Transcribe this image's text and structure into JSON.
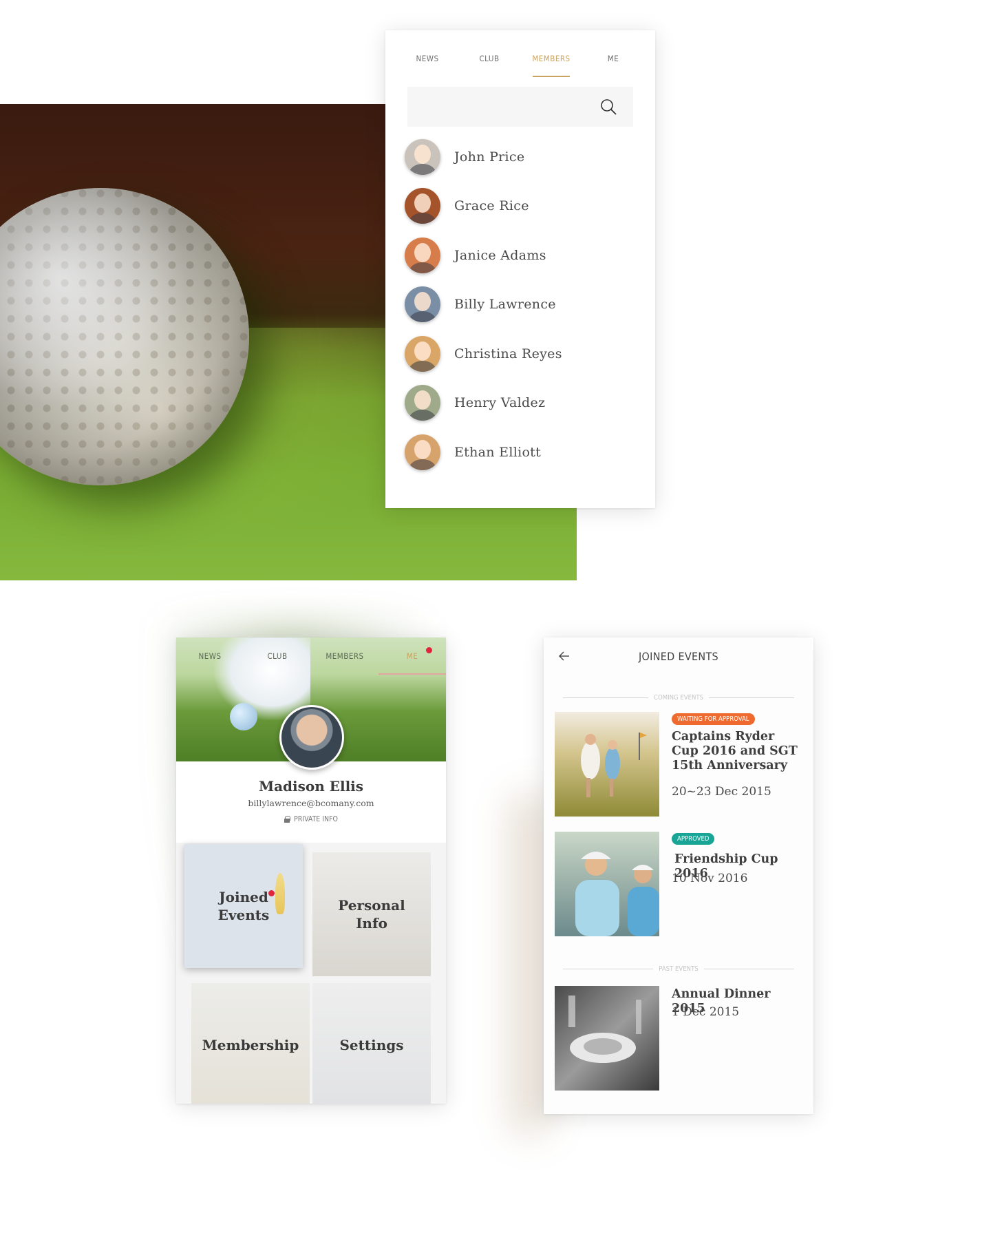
{
  "members_screen": {
    "tabs": [
      {
        "label": "NEWS"
      },
      {
        "label": "CLUB"
      },
      {
        "label": "MEMBERS"
      },
      {
        "label": "ME"
      }
    ],
    "active_tab": "MEMBERS",
    "search": {
      "value": "",
      "placeholder": ""
    },
    "members": [
      {
        "name": "John Price",
        "avatar_color": "#c9c3bb"
      },
      {
        "name": "Grace Rice",
        "avatar_color": "#a4532a"
      },
      {
        "name": "Janice Adams",
        "avatar_color": "#d77d4b"
      },
      {
        "name": "Billy Lawrence",
        "avatar_color": "#7a8fa6"
      },
      {
        "name": "Christina Reyes",
        "avatar_color": "#d9a667"
      },
      {
        "name": "Henry Valdez",
        "avatar_color": "#9eaa8a"
      },
      {
        "name": "Ethan Elliott",
        "avatar_color": "#d7a36c"
      }
    ]
  },
  "profile_screen": {
    "tabs": [
      {
        "label": "NEWS"
      },
      {
        "label": "CLUB"
      },
      {
        "label": "MEMBERS"
      },
      {
        "label": "ME"
      }
    ],
    "active_tab": "ME",
    "name": "Madison Ellis",
    "email": "billylawrence@bcomany.com",
    "private_label": "PRIVATE INFO",
    "tiles": {
      "joined_events": "Joined Events",
      "personal_info": "Personal Info",
      "membership": "Membership",
      "settings": "Settings"
    }
  },
  "events_screen": {
    "title": "JOINED EVENTS",
    "coming_label": "COMING EVENTS",
    "past_label": "PAST EVENTS",
    "coming_events": [
      {
        "status": "WAITING FOR APPROVAL",
        "status_color": "#ef6a2f",
        "title": "Captains Ryder Cup 2016 and SGT 15th Anniversary",
        "date": "20~23 Dec 2015"
      },
      {
        "status": "APPROVED",
        "status_color": "#18a596",
        "title": "Friendship Cup 2016",
        "date": "10 Nov 2016"
      }
    ],
    "past_events": [
      {
        "title": "Annual Dinner 2015",
        "date": "1 Dec 2015"
      }
    ]
  },
  "colors": {
    "accent": "#c9a35f",
    "notification": "#e0263c"
  }
}
